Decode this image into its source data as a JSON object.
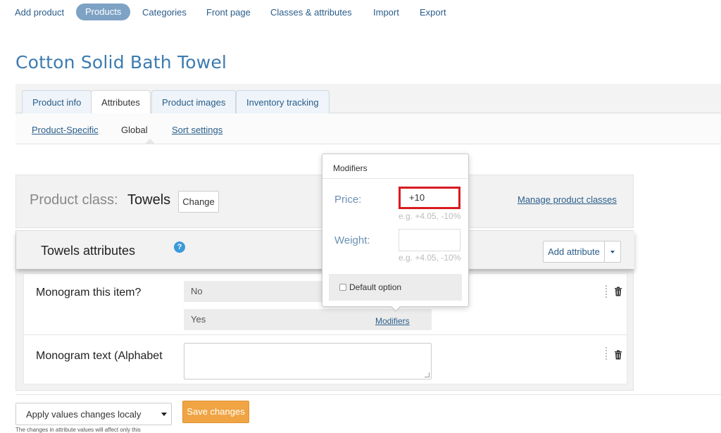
{
  "nav": {
    "add_product": "Add product",
    "products": "Products",
    "categories": "Categories",
    "front_page": "Front page",
    "classes_attributes": "Classes & attributes",
    "import": "Import",
    "export": "Export"
  },
  "page": {
    "title": "Cotton Solid Bath Towel"
  },
  "tabs": {
    "product_info": "Product info",
    "attributes": "Attributes",
    "product_images": "Product images",
    "inventory_tracking": "Inventory tracking"
  },
  "subtabs": {
    "product_specific": "Product-Specific",
    "global": "Global",
    "sort_settings": "Sort settings"
  },
  "product_class": {
    "label": "Product class:",
    "value": "Towels",
    "change_label": "Change",
    "manage_link": "Manage product classes"
  },
  "attributes_panel": {
    "title": "Towels attributes",
    "help_glyph": "?",
    "add_button": "Add attribute",
    "rows": [
      {
        "name": "Monogram this item?",
        "values": [
          "No",
          "Yes"
        ],
        "modifiers_link": "Modifiers"
      },
      {
        "name": "Monogram text (Alphabet"
      }
    ]
  },
  "popover": {
    "title": "Modifiers",
    "price_label": "Price:",
    "price_value": "+10",
    "price_hint": "e.g. +4.05, -10%",
    "weight_label": "Weight:",
    "weight_value": "",
    "weight_hint": "e.g. +4.05, -10%",
    "default_option": "Default option",
    "highlight_color": "#d81b21"
  },
  "footer": {
    "apply_select": "Apply values changes localy",
    "save_button": "Save changes",
    "note": "The changes in attribute values will affect only this"
  },
  "colors": {
    "accent_link": "#2a5d8a",
    "title": "#3c7bb0",
    "nav_pill": "#7da2c4",
    "save_button": "#f0a443"
  },
  "icons": [
    "help-icon",
    "trash-icon",
    "drag-handle-icon",
    "chevron-down-icon",
    "resize-grip-icon"
  ]
}
